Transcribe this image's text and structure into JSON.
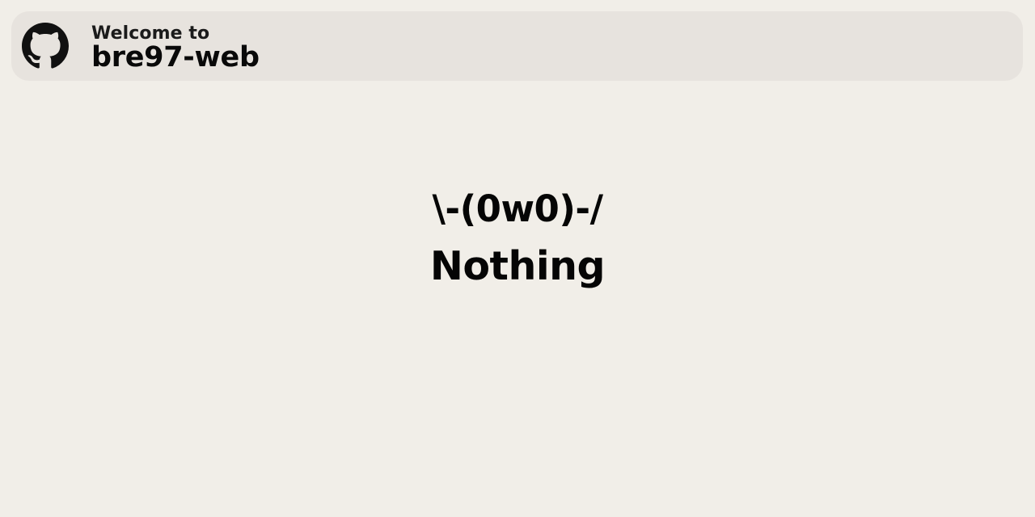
{
  "header": {
    "logo_icon": "github-icon",
    "welcome_text": "Welcome to",
    "site_name": "bre97-web"
  },
  "main": {
    "emote": "\\-(0w0)-/",
    "status": "Nothing"
  },
  "colors": {
    "page_background": "#f1eee8",
    "header_background": "#e7e3de",
    "text": "#111111"
  }
}
